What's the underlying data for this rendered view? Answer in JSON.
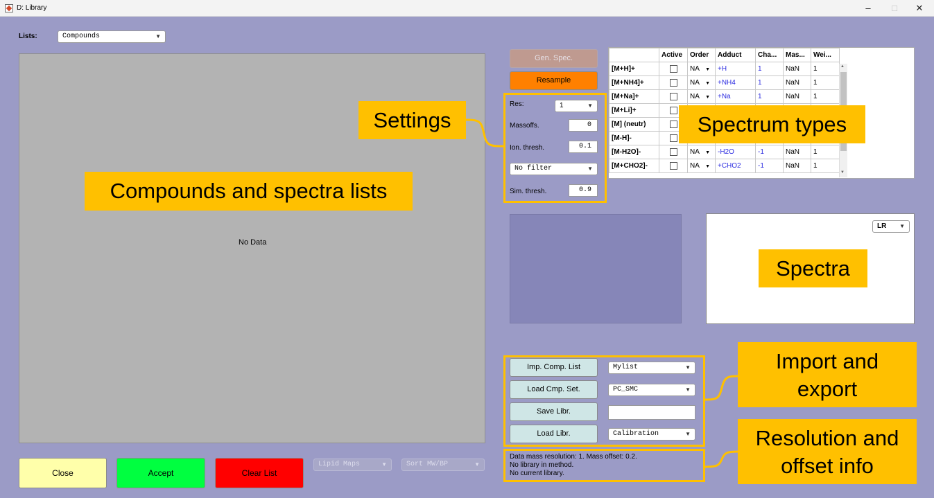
{
  "window": {
    "title": "D: Library",
    "minimize": "–",
    "maximize": "□",
    "close": "✕"
  },
  "lists": {
    "label": "Lists:",
    "selected": "Compounds"
  },
  "main_panel": {
    "empty_text": "No Data"
  },
  "buttons": {
    "gen_spec": "Gen. Spec.",
    "resample": "Resample",
    "imp_comp_list": "Imp. Comp. List",
    "load_cmp_set": "Load Cmp. Set.",
    "save_libr": "Save Libr.",
    "load_libr": "Load Libr.",
    "close": "Close",
    "accept": "Accept",
    "clear_list": "Clear List"
  },
  "settings": {
    "res_label": "Res:",
    "res_value": "1",
    "massoffs_label": "Massoffs.",
    "massoffs_value": "0",
    "ion_thresh_label": "Ion. thresh.",
    "ion_thresh_value": "0.1",
    "filter_value": "No filter",
    "sim_thresh_label": "Sim. thresh.",
    "sim_thresh_value": "0.9"
  },
  "import_export": {
    "mylist_value": "Mylist",
    "cmp_set_value": "PC_SMC",
    "save_name_value": "",
    "library_value": "Calibration"
  },
  "bottom_popups": {
    "lipid_maps": "Lipid Maps",
    "sort": "Sort MW/BP"
  },
  "spectra": {
    "mode_value": "LR"
  },
  "spectrum_table": {
    "headers": [
      "",
      "Active",
      "Order",
      "Adduct",
      "Cha...",
      "Mas...",
      "Wei..."
    ],
    "rows": [
      {
        "name": "[M+H]+",
        "order": "NA",
        "adduct": "+H",
        "charge": "1",
        "mass": "NaN",
        "weight": "1"
      },
      {
        "name": "[M+NH4]+",
        "order": "NA",
        "adduct": "+NH4",
        "charge": "1",
        "mass": "NaN",
        "weight": "1"
      },
      {
        "name": "[M+Na]+",
        "order": "NA",
        "adduct": "+Na",
        "charge": "1",
        "mass": "NaN",
        "weight": "1"
      },
      {
        "name": "[M+Li]+",
        "order": "",
        "adduct": "",
        "charge": "",
        "mass": "",
        "weight": ""
      },
      {
        "name": "[M] (neutr)",
        "order": "",
        "adduct": "",
        "charge": "",
        "mass": "",
        "weight": ""
      },
      {
        "name": "[M-H]-",
        "order": "",
        "adduct": "",
        "charge": "",
        "mass": "",
        "weight": ""
      },
      {
        "name": "[M-H2O]-",
        "order": "NA",
        "adduct": "-H2O",
        "charge": "-1",
        "mass": "NaN",
        "weight": "1"
      },
      {
        "name": "[M+CHO2]-",
        "order": "NA",
        "adduct": "+CHO2",
        "charge": "-1",
        "mass": "NaN",
        "weight": "1"
      }
    ]
  },
  "info": {
    "line1": "Data mass resolution: 1. Mass offset: 0.2.",
    "line2": "No library in method.",
    "line3": "No current library."
  },
  "annotations": {
    "settings": "Settings",
    "compounds_lists": "Compounds and spectra lists",
    "spectrum_types": "Spectrum types",
    "spectra": "Spectra",
    "import_export_1": "Import and",
    "import_export_2": "export",
    "resolution_1": "Resolution and",
    "resolution_2": "offset info"
  },
  "colors": {
    "background": "#9b9bc6",
    "accent_orange": "#ff8000",
    "accept_green": "#00ff40",
    "clear_red": "#ff0000",
    "close_yellow": "#ffffaa",
    "callout": "#ffc000"
  }
}
